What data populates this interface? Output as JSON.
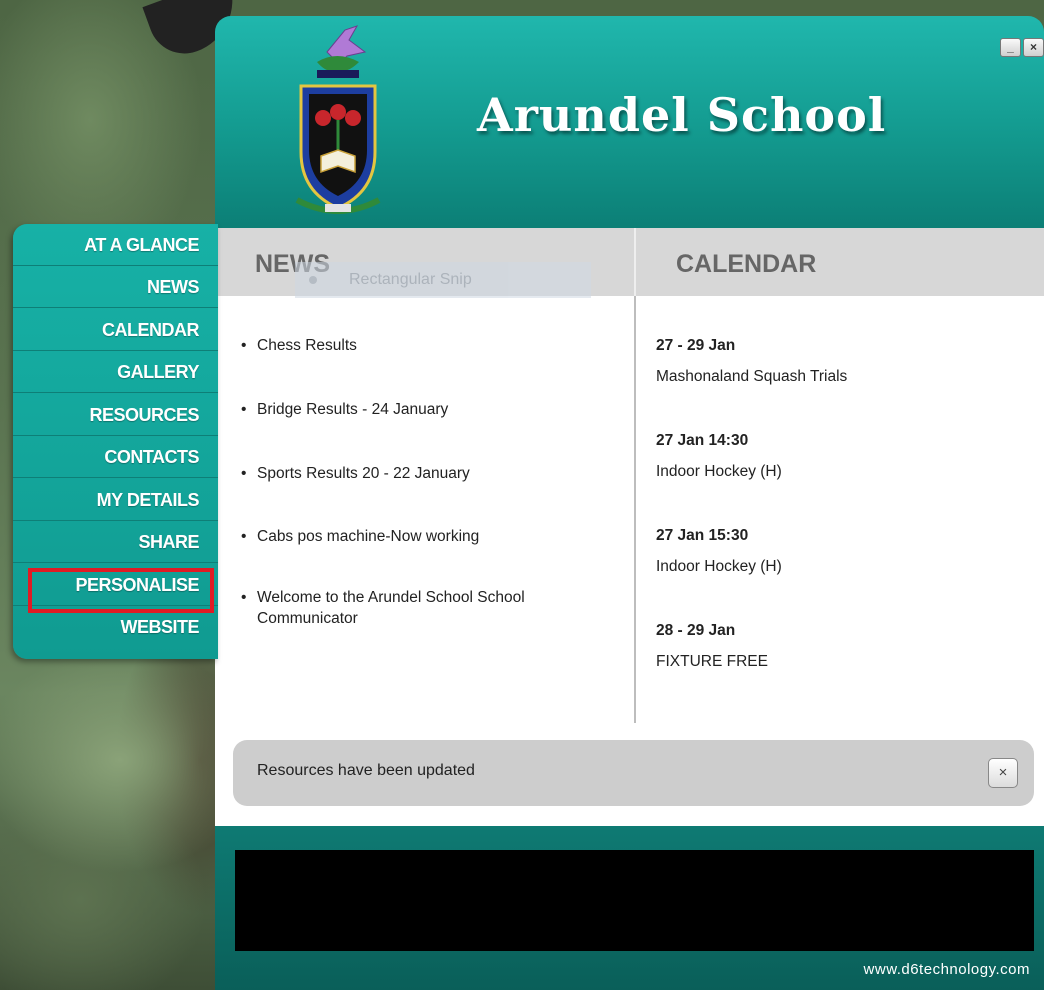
{
  "app": {
    "school_name": "Arundel School",
    "window_buttons": {
      "minimize": "_",
      "close": "×"
    }
  },
  "nav": {
    "items": [
      {
        "label": "AT A GLANCE"
      },
      {
        "label": "NEWS"
      },
      {
        "label": "CALENDAR"
      },
      {
        "label": "GALLERY"
      },
      {
        "label": "RESOURCES"
      },
      {
        "label": "CONTACTS"
      },
      {
        "label": "MY DETAILS"
      },
      {
        "label": "SHARE"
      },
      {
        "label": "PERSONALISE",
        "highlighted": true
      },
      {
        "label": "WEBSITE"
      }
    ]
  },
  "news": {
    "heading": "NEWS",
    "items": [
      "Chess Results",
      "Bridge Results - 24 January",
      "Sports Results 20 - 22 January",
      "Cabs pos machine-Now working",
      "Welcome to the Arundel School School Communicator"
    ]
  },
  "snip_overlay": {
    "label": "Rectangular Snip"
  },
  "calendar": {
    "heading": "CALENDAR",
    "events": [
      {
        "date": "27 - 29 Jan",
        "title": "Mashonaland Squash Trials"
      },
      {
        "date": "27 Jan 14:30",
        "title": "Indoor Hockey (H)"
      },
      {
        "date": "27 Jan 15:30",
        "title": "Indoor Hockey (H)"
      },
      {
        "date": "28 - 29 Jan",
        "title": "FIXTURE FREE"
      }
    ]
  },
  "notification": {
    "text": "Resources have been updated",
    "close_label": "×"
  },
  "footer": {
    "url": "www.d6technology.com"
  },
  "colors": {
    "teal": "#139a8f",
    "highlight": "#e01b24"
  }
}
